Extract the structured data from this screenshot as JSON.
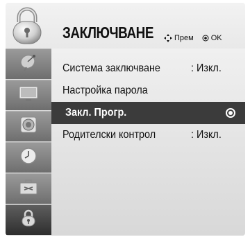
{
  "header": {
    "title": "ЗАКЛЮЧВАНЕ",
    "hint_move": "Прем",
    "hint_ok": "OK",
    "icon": "lock-icon"
  },
  "sidebar": {
    "items": [
      {
        "icon": "satellite-dish-icon"
      },
      {
        "icon": "tv-screen-icon"
      },
      {
        "icon": "speaker-icon"
      },
      {
        "icon": "clock-icon"
      },
      {
        "icon": "toolbox-icon"
      },
      {
        "icon": "lock-icon"
      }
    ]
  },
  "menu": {
    "items": [
      {
        "label": "Система заключване",
        "value": ": Изкл."
      },
      {
        "label": "Настройка парола",
        "value": ""
      },
      {
        "label": "Закл. Прогр.",
        "value": ""
      },
      {
        "label": "Родителски контрол",
        "value": ": Изкл."
      }
    ],
    "selected_index": 2
  }
}
